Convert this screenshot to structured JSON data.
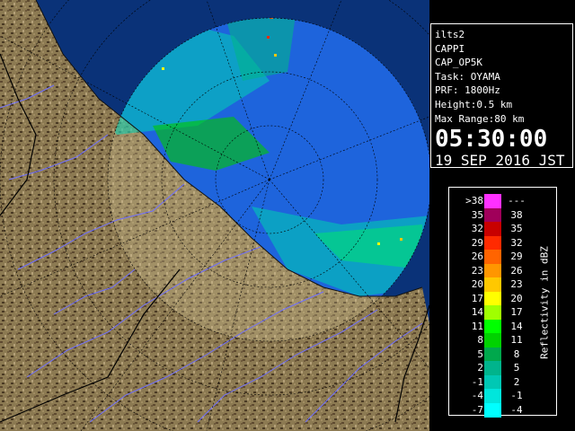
{
  "info": {
    "station": "ilts2",
    "product": "CAPPI",
    "product_code": "CAP_OP5K",
    "task": "Task: OYAMA",
    "prf": "PRF: 1800Hz",
    "height": "Height:0.5 km",
    "max_range": "Max Range:80 km",
    "time": "05:30:00",
    "date": "19 SEP 2016 JST"
  },
  "legend": {
    "title": "Reflectivity in dBZ",
    "rows": [
      {
        "low": ">38",
        "high": "---",
        "color": "#ff30ff"
      },
      {
        "low": "35",
        "high": "38",
        "color": "#a0005a"
      },
      {
        "low": "32",
        "high": "35",
        "color": "#c80000"
      },
      {
        "low": "29",
        "high": "32",
        "color": "#ff2a00"
      },
      {
        "low": "26",
        "high": "29",
        "color": "#ff6400"
      },
      {
        "low": "23",
        "high": "26",
        "color": "#ff9600"
      },
      {
        "low": "20",
        "high": "23",
        "color": "#ffc800"
      },
      {
        "low": "17",
        "high": "20",
        "color": "#ffff00"
      },
      {
        "low": "14",
        "high": "17",
        "color": "#a0ff00"
      },
      {
        "low": "11",
        "high": "14",
        "color": "#00ff00"
      },
      {
        "low": "8",
        "high": "11",
        "color": "#00d200"
      },
      {
        "low": "5",
        "high": "8",
        "color": "#00a84c"
      },
      {
        "low": "2",
        "high": "5",
        "color": "#00b48c"
      },
      {
        "low": "-1",
        "high": "2",
        "color": "#00c8b4"
      },
      {
        "low": "-4",
        "high": "-1",
        "color": "#00e6dc"
      },
      {
        "low": "-7",
        "high": "-4",
        "color": "#00ffff"
      }
    ]
  },
  "colors": {
    "sea_in_range": "#1e64dc",
    "sea_far": "#0a3278",
    "land_far": "#6e5a3c",
    "land_near": "#8c7a52",
    "rivers": "#7070ff",
    "range_rings": "#000000",
    "prefecture_border": "#000000"
  }
}
